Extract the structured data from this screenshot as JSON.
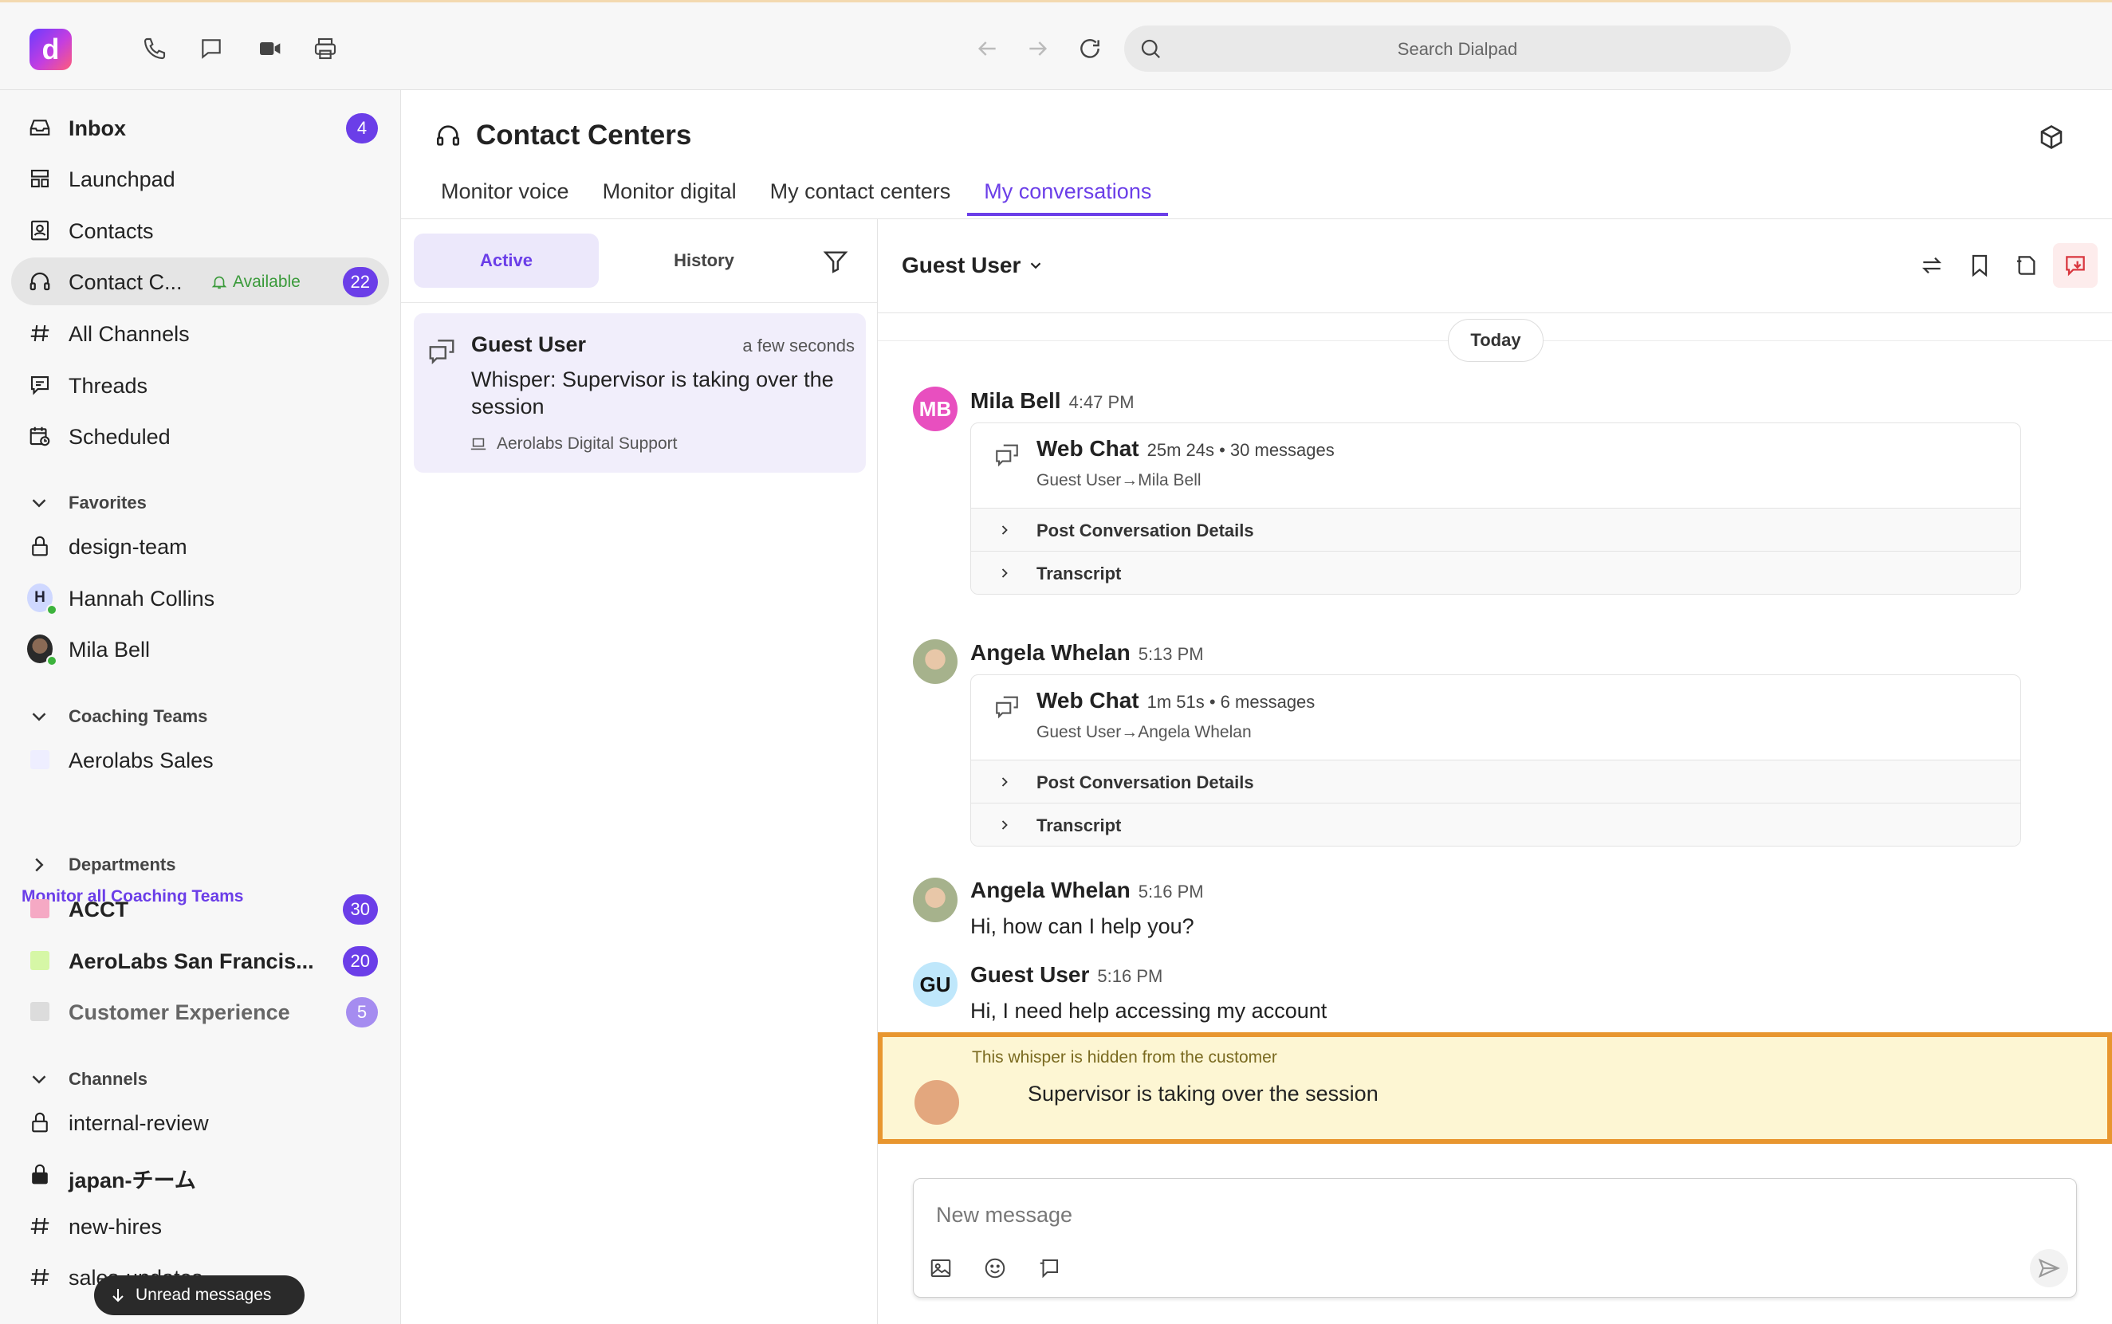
{
  "topbar": {
    "logo_letter": "d",
    "search_placeholder": "Search Dialpad",
    "icons": [
      "phone-icon",
      "message-icon",
      "video-icon",
      "printer-icon",
      "back-arrow-icon",
      "forward-arrow-icon",
      "refresh-icon",
      "search-icon"
    ]
  },
  "sidebar": {
    "items": [
      {
        "label": "Inbox",
        "badge": "4",
        "icon": "inbox-icon"
      },
      {
        "label": "Launchpad",
        "icon": "launchpad-icon"
      },
      {
        "label": "Contacts",
        "icon": "contacts-icon"
      },
      {
        "label": "Contact C...",
        "status": "Available",
        "badge": "22",
        "icon": "headset-icon"
      },
      {
        "label": "All Channels",
        "icon": "hash-icon"
      },
      {
        "label": "Threads",
        "icon": "threads-icon"
      },
      {
        "label": "Scheduled",
        "icon": "calendar-clock-icon"
      }
    ],
    "favorites": {
      "heading": "Favorites",
      "items": [
        {
          "label": "design-team"
        },
        {
          "label": "Hannah Collins",
          "initial": "H"
        },
        {
          "label": "Mila Bell"
        }
      ]
    },
    "coaching": {
      "heading": "Coaching Teams",
      "items": [
        {
          "label": "Aerolabs Sales"
        }
      ],
      "monitor_link": "Monitor all Coaching Teams"
    },
    "departments": {
      "heading": "Departments",
      "items": [
        {
          "label": "ACCT",
          "badge": "30",
          "color": "#f5a9c4"
        },
        {
          "label": "AeroLabs San Francis...",
          "badge": "20",
          "color": "#d6f7a6"
        },
        {
          "label": "Customer Experience",
          "badge": "5",
          "color": "#dcdcdc"
        }
      ]
    },
    "channels": {
      "heading": "Channels",
      "items": [
        {
          "label": "internal-review"
        },
        {
          "label": "japan-チーム"
        },
        {
          "label": "new-hires"
        },
        {
          "label": "sales-updates"
        }
      ]
    },
    "unread_pill": "Unread messages"
  },
  "contact_centers": {
    "title": "Contact Centers",
    "tabs": [
      {
        "label": "Monitor voice"
      },
      {
        "label": "Monitor digital"
      },
      {
        "label": "My contact centers"
      },
      {
        "label": "My conversations",
        "active": true
      }
    ]
  },
  "conversation_list": {
    "segments": {
      "active": "Active",
      "history": "History"
    },
    "items": [
      {
        "name": "Guest User",
        "time": "a few seconds",
        "message": "Whisper: Supervisor is taking over the session",
        "source": "Aerolabs Digital Support"
      }
    ]
  },
  "chat": {
    "header_name": "Guest User",
    "date_divider": "Today",
    "messages": [
      {
        "initials": "MB",
        "name": "Mila Bell",
        "time": "4:47 PM",
        "avatar_color": "#e84fbf",
        "card": {
          "title": "Web Chat",
          "meta": "25m 24s • 30 messages",
          "route": "Guest User→Mila Bell",
          "rows": [
            "Post Conversation Details",
            "Transcript"
          ]
        }
      },
      {
        "name": "Angela Whelan",
        "time": "5:13 PM",
        "card": {
          "title": "Web Chat",
          "meta": "1m 51s • 6 messages",
          "route": "Guest User→Angela Whelan",
          "rows": [
            "Post Conversation Details",
            "Transcript"
          ]
        }
      },
      {
        "name": "Angela Whelan",
        "time": "5:16 PM",
        "text": "Hi, how can I help you?"
      },
      {
        "initials": "GU",
        "name": "Guest User",
        "time": "5:16 PM",
        "text": "Hi, I need help accessing my account",
        "avatar_color": "#bfe7fb"
      }
    ],
    "whisper": {
      "note": "This whisper is hidden from the customer",
      "text": "Supervisor is taking over the session"
    },
    "composer": {
      "placeholder": "New message"
    }
  }
}
